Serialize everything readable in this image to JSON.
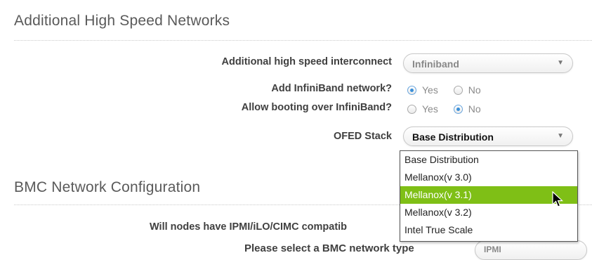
{
  "section1": {
    "title": "Additional High Speed Networks",
    "interconnect_label": "Additional high speed interconnect",
    "interconnect_value": "Infiniband",
    "add_ib_label": "Add InfiniBand network?",
    "allow_boot_label": "Allow booting over InfiniBand?",
    "yes": "Yes",
    "no": "No",
    "ofed_label": "OFED Stack",
    "ofed_value": "Base Distribution",
    "add_ib_selected": "Yes",
    "allow_boot_selected": "No"
  },
  "dropdown": {
    "options": [
      "Base Distribution",
      "Mellanox(v 3.0)",
      "Mellanox(v 3.1)",
      "Mellanox(v 3.2)",
      "Intel True Scale"
    ],
    "highlighted": "Mellanox(v 3.1)",
    "highlight_color": "#7fbf16"
  },
  "section2": {
    "title": "BMC Network Configuration",
    "ipmi_label": "Will nodes have IPMI/iLO/CIMC compatib",
    "bmc_type_label": "Please select a BMC network type",
    "bmc_type_value": "IPMI"
  },
  "icons": {
    "caret": "chevron-down-icon",
    "cursor": "mouse-pointer-icon"
  }
}
